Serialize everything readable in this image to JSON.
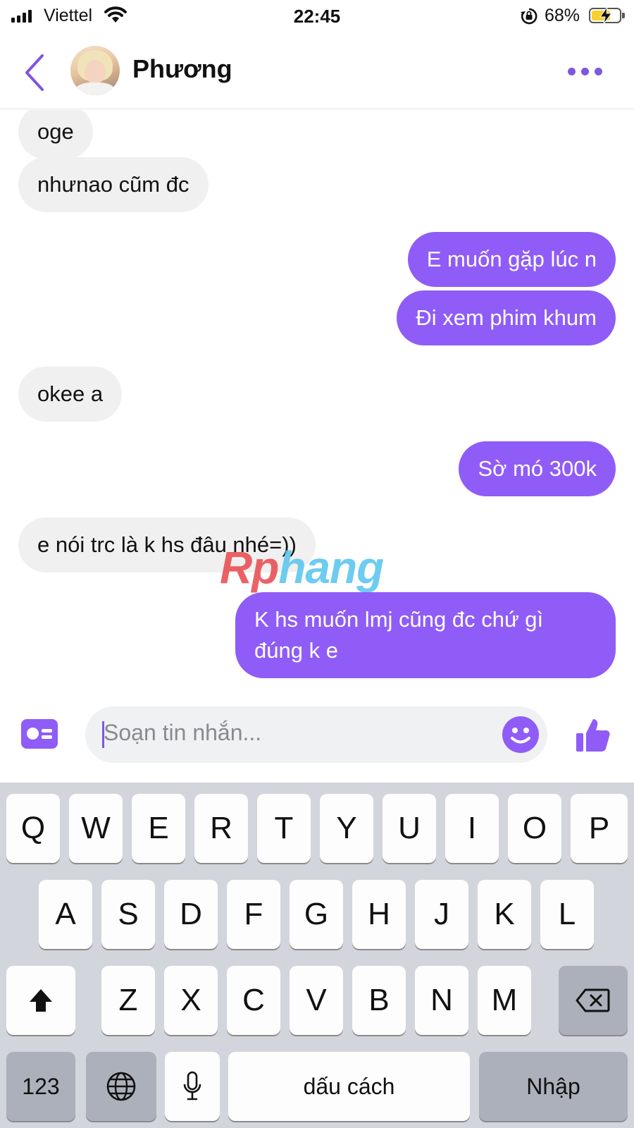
{
  "status_bar": {
    "carrier": "Viettel",
    "time": "22:45",
    "battery_percent_label": "68%",
    "battery_level": 0.68
  },
  "header": {
    "contact_name": "Phương",
    "icons": {
      "back": "chevron-left-icon",
      "more": "more-dots-icon"
    }
  },
  "messages": [
    {
      "side": "in",
      "text": "oge"
    },
    {
      "side": "in",
      "text": "nhưnao cũm đc"
    },
    {
      "side": "out",
      "text": "E muốn gặp lúc n"
    },
    {
      "side": "out",
      "text": "Đi xem phim khum"
    },
    {
      "side": "in",
      "text": "okee a"
    },
    {
      "side": "out",
      "text": "Sờ mó 300k"
    },
    {
      "side": "in",
      "text": "e nói trc là k hs đâu nhé=))"
    },
    {
      "side": "out",
      "text": "K hs muốn lmj cũng đc chứ gì đúng k e"
    }
  ],
  "watermark": {
    "part1": "Rp",
    "part2": "hang"
  },
  "composer": {
    "placeholder": "Soạn tin nhắn...",
    "icons": {
      "card": "contact-card-icon",
      "emoji": "smiley-icon",
      "like": "thumbs-up-icon"
    }
  },
  "keyboard": {
    "row1": [
      "Q",
      "W",
      "E",
      "R",
      "T",
      "Y",
      "U",
      "I",
      "O",
      "P"
    ],
    "row2": [
      "A",
      "S",
      "D",
      "F",
      "G",
      "H",
      "J",
      "K",
      "L"
    ],
    "row3": [
      "Z",
      "X",
      "C",
      "V",
      "B",
      "N",
      "M"
    ],
    "numbers_key": "123",
    "space_key": "dấu cách",
    "return_key": "Nhập",
    "icons": {
      "shift": "shift-icon",
      "backspace": "backspace-icon",
      "globe": "globe-icon",
      "mic": "microphone-icon"
    }
  },
  "colors": {
    "accent": "#8f5cf7",
    "incoming_bubble": "#f0f0f0",
    "keyboard_bg": "#d2d5db"
  }
}
